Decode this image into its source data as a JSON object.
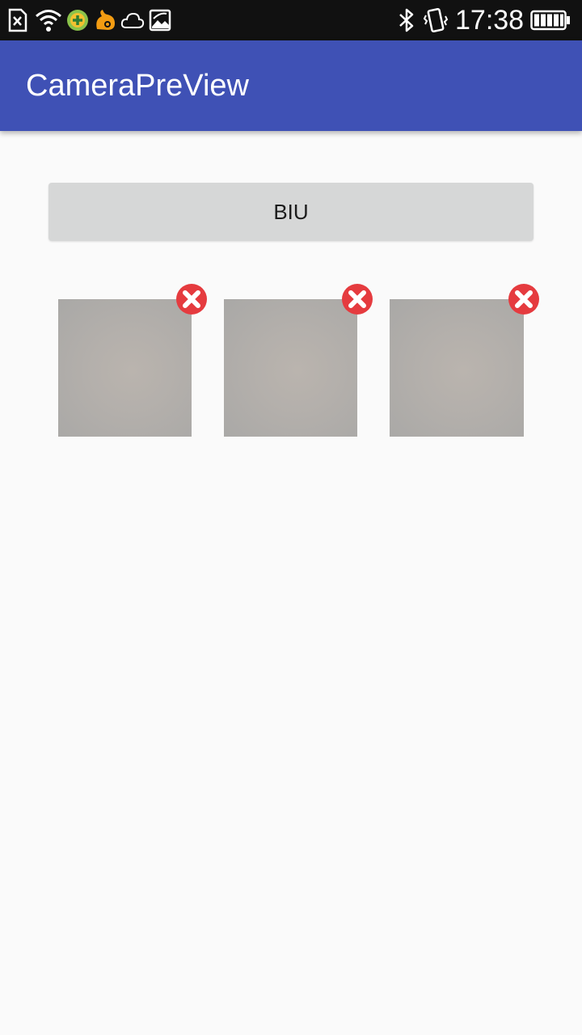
{
  "status_bar": {
    "time": "17:38",
    "icons": [
      "sim-error-icon",
      "wifi-icon",
      "app-store-icon",
      "uc-browser-icon",
      "cloud-icon",
      "image-icon",
      "bluetooth-icon",
      "vibrate-icon",
      "battery-icon"
    ]
  },
  "app_bar": {
    "title": "CameraPreView",
    "color": "#3f51b5"
  },
  "main": {
    "button_label": "BIU",
    "photos": [
      {
        "delete_icon": "delete-icon"
      },
      {
        "delete_icon": "delete-icon"
      },
      {
        "delete_icon": "delete-icon"
      }
    ],
    "delete_color": "#e53935"
  }
}
